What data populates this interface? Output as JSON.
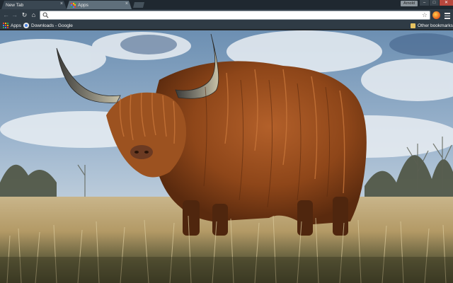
{
  "tabs": [
    {
      "label": "New Tab",
      "active": false
    },
    {
      "label": "Apps",
      "active": true
    }
  ],
  "profile": {
    "name": "Arnold"
  },
  "window_controls": {
    "minimize": "–",
    "maximize": "□",
    "close": "✕"
  },
  "toolbar": {
    "back_icon": "back-arrow-icon",
    "forward_icon": "forward-arrow-icon",
    "reload_icon": "reload-icon",
    "home_icon": "home-icon",
    "omnibox_value": "",
    "omnibox_placeholder": "",
    "star_icon": "star-icon",
    "extension_icon": "extension-icon",
    "menu_icon": "menu-icon"
  },
  "bookmarks": {
    "apps_label": "Apps",
    "items": [
      {
        "label": "Downloads - Google"
      }
    ],
    "other_label": "Other bookmarks"
  },
  "background": {
    "subject": "highland-cattle-photo"
  },
  "colors": {
    "tabstrip": "#1f2830",
    "toolbar": "#2f3b45",
    "active_tab": "#5f6f7b",
    "inactive_tab": "#3a4752"
  }
}
